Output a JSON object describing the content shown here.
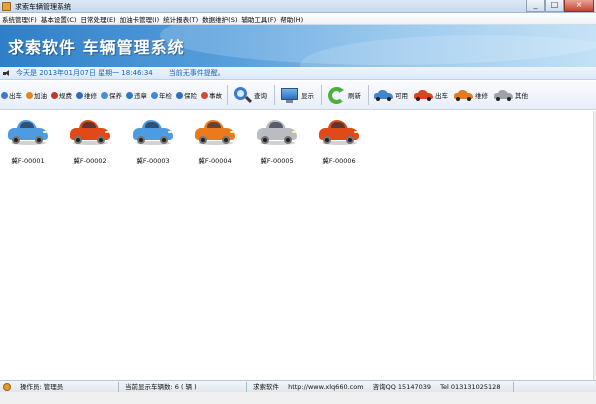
{
  "window": {
    "title": "求索车辆管理系统",
    "buttons": [
      "_",
      "□",
      "×"
    ]
  },
  "menubar": {
    "items": [
      "系统管理(F)",
      "基本设置(C)",
      "日常处理(E)",
      "加油卡管理(I)",
      "统计报表(T)",
      "数据维护(S)",
      "辅助工具(F)",
      "帮助(H)"
    ]
  },
  "banner": {
    "title": "求索软件  车辆管理系统"
  },
  "infobar": {
    "date_text": "今天是 2013年01月07日 星期一 18:46:34",
    "notice": "当前无事件提醒。"
  },
  "toolbar": {
    "small_buttons": [
      {
        "label": "出车",
        "color": "#3a7bd0"
      },
      {
        "label": "加油",
        "color": "#e0891f"
      },
      {
        "label": "规费",
        "color": "#c0392b"
      },
      {
        "label": "维修",
        "color": "#2f6fb8"
      },
      {
        "label": "保养",
        "color": "#4a8fd6"
      },
      {
        "label": "违章",
        "color": "#2f78c7"
      },
      {
        "label": "年检",
        "color": "#3d8ad9"
      },
      {
        "label": "保险",
        "color": "#2e6fc0"
      },
      {
        "label": "事故",
        "color": "#d14b2e"
      }
    ],
    "query": "查询",
    "display": "显示",
    "refresh": "刷新",
    "status_filters": [
      {
        "label": "可用",
        "color": "#3f86cf"
      },
      {
        "label": "出车",
        "color": "#d9441c"
      },
      {
        "label": "维修",
        "color": "#e57a1e"
      },
      {
        "label": "其他",
        "color": "#9ea3a9"
      }
    ]
  },
  "vehicles": [
    {
      "plate": "冀F-00001",
      "color": "#4d9be0"
    },
    {
      "plate": "冀F-00002",
      "color": "#e04a18"
    },
    {
      "plate": "冀F-00003",
      "color": "#4d9be0"
    },
    {
      "plate": "冀F-00004",
      "color": "#ea7a1d"
    },
    {
      "plate": "冀F-00005",
      "color": "#b9bdc2"
    },
    {
      "plate": "冀F-00006",
      "color": "#e04a18"
    }
  ],
  "statusbar": {
    "operator": "操作员: 管理员",
    "vehicle_count": "当前显示车辆数: 6 ( 辆 )",
    "company": "求索软件",
    "website": "http://www.xlq660.com",
    "qq": "咨询QQ 15147039",
    "tel": "Tel 013131025128"
  }
}
